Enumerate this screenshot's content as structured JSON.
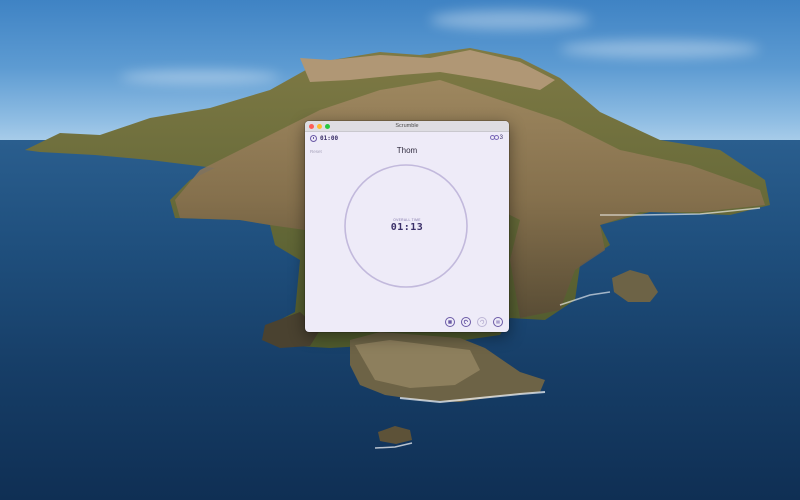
{
  "window": {
    "title": "Scrumble"
  },
  "header": {
    "timebox": "01:00",
    "participant_count": "3"
  },
  "main": {
    "reset_label": "Reset",
    "current_speaker": "Thom",
    "overall_label": "OVERALL TIME",
    "overall_time": "01:13"
  },
  "controls": [
    {
      "name": "stop-icon",
      "enabled": true
    },
    {
      "name": "previous-icon",
      "enabled": true
    },
    {
      "name": "next-icon",
      "enabled": false
    },
    {
      "name": "pause-icon",
      "enabled": true
    }
  ],
  "colors": {
    "accent": "#6b5aa6",
    "ring": "#c2b9dc",
    "window_bg": "#eeebf8"
  }
}
